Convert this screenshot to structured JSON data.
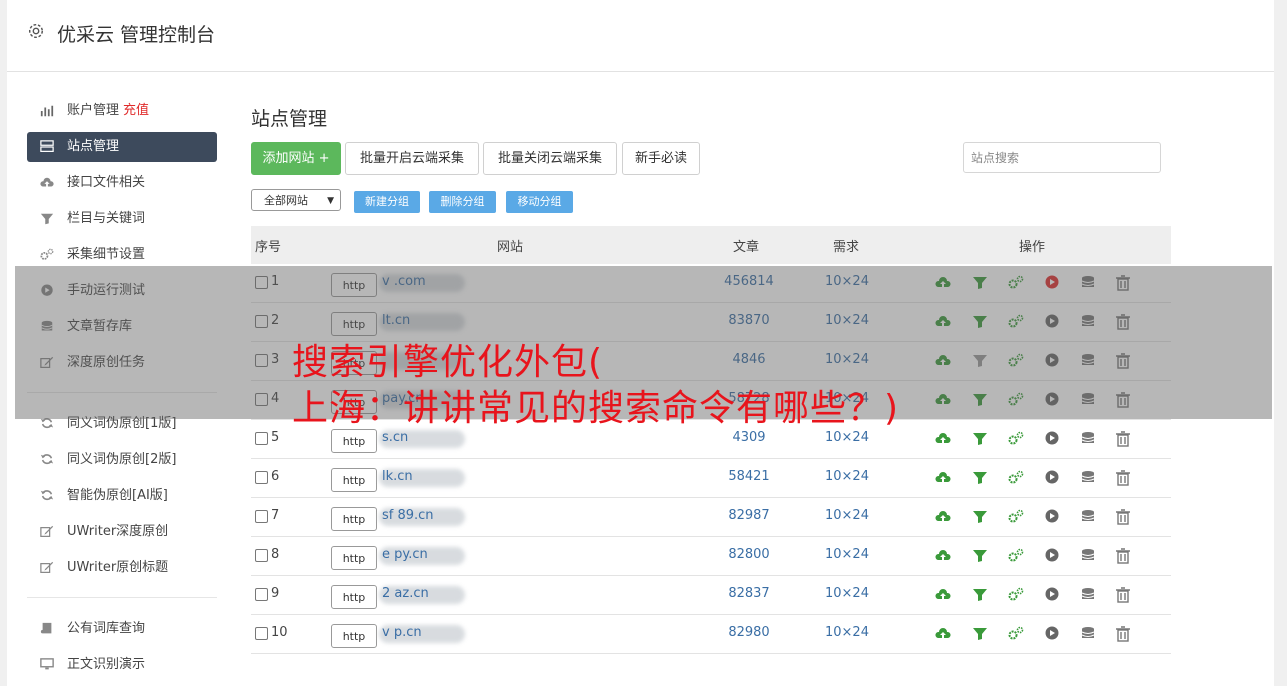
{
  "app": {
    "title": "优采云 管理控制台"
  },
  "sidebar": {
    "group1": [
      {
        "label": "账户管理",
        "extra": "充值",
        "icon": "bar-chart-icon",
        "active": false
      },
      {
        "label": "站点管理",
        "icon": "server-icon",
        "active": true
      },
      {
        "label": "接口文件相关",
        "icon": "cloud-upload-icon",
        "active": false
      },
      {
        "label": "栏目与关键词",
        "icon": "filter-icon",
        "active": false
      },
      {
        "label": "采集细节设置",
        "icon": "gears-icon",
        "active": false
      },
      {
        "label": "手动运行测试",
        "icon": "play-circle-icon",
        "active": false
      },
      {
        "label": "文章暂存库",
        "icon": "database-icon",
        "active": false
      },
      {
        "label": "深度原创任务",
        "icon": "edit-icon",
        "active": false
      }
    ],
    "group2": [
      {
        "label": "同义词伪原创[1版]",
        "icon": "refresh-icon"
      },
      {
        "label": "同义词伪原创[2版]",
        "icon": "refresh-icon"
      },
      {
        "label": "智能伪原创[AI版]",
        "icon": "refresh-icon"
      },
      {
        "label": "UWriter深度原创",
        "icon": "edit-icon"
      },
      {
        "label": "UWriter原创标题",
        "icon": "edit-icon"
      }
    ],
    "group3": [
      {
        "label": "公有词库查询",
        "icon": "book-icon"
      },
      {
        "label": "正文识别演示",
        "icon": "monitor-icon"
      }
    ]
  },
  "main": {
    "title": "站点管理",
    "toolbar": {
      "add_site": "添加网站 +",
      "batch_open": "批量开启云端采集",
      "batch_close": "批量关闭云端采集",
      "newbie": "新手必读"
    },
    "search": {
      "placeholder": "站点搜索"
    },
    "group_select": "全部网站",
    "group_buttons": {
      "new": "新建分组",
      "delete": "删除分组",
      "move": "移动分组"
    },
    "table": {
      "headers": {
        "no": "序号",
        "site": "网站",
        "articles": "文章",
        "demand": "需求",
        "ops": "操作"
      },
      "rows": [
        {
          "no": "1",
          "scheme": "http",
          "site": "v          .com",
          "articles": "456814",
          "demand": "10×24",
          "running": true
        },
        {
          "no": "2",
          "scheme": "http",
          "site": "      lt.cn",
          "articles": "83870",
          "demand": "10×24",
          "running": false
        },
        {
          "no": "3",
          "scheme": "http",
          "site": "",
          "articles": "4846",
          "demand": "10×24",
          "running": false
        },
        {
          "no": "4",
          "scheme": "http",
          "site": "      pay.cn",
          "articles": "58728",
          "demand": "10×24",
          "running": false
        },
        {
          "no": "5",
          "scheme": "http",
          "site": "       s.cn",
          "articles": "4309",
          "demand": "10×24",
          "running": false
        },
        {
          "no": "6",
          "scheme": "http",
          "site": "      lk.cn",
          "articles": "58421",
          "demand": "10×24",
          "running": false
        },
        {
          "no": "7",
          "scheme": "http",
          "site": "sf   89.cn",
          "articles": "82987",
          "demand": "10×24",
          "running": false
        },
        {
          "no": "8",
          "scheme": "http",
          "site": "e      py.cn",
          "articles": "82800",
          "demand": "10×24",
          "running": false
        },
        {
          "no": "9",
          "scheme": "http",
          "site": "2     az.cn",
          "articles": "82837",
          "demand": "10×24",
          "running": false
        },
        {
          "no": "10",
          "scheme": "http",
          "site": "v     p.cn",
          "articles": "82980",
          "demand": "10×24",
          "running": false
        }
      ]
    }
  },
  "overlay": {
    "line1": "搜索引擎优化外包(",
    "line2": "上海：讲讲常见的搜索命令有哪些？)"
  },
  "colors": {
    "accent": "#3d4a5c",
    "green": "#5cb85c",
    "blue_btn": "#5aa9e6",
    "link": "#3a6ea5",
    "overlay_text": "#e8141c"
  }
}
